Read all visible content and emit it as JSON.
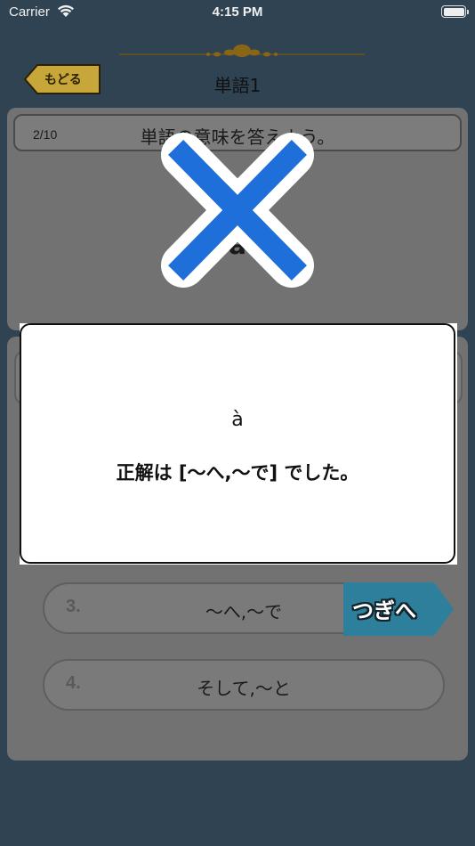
{
  "status_bar": {
    "carrier": "Carrier",
    "time": "4:15 PM"
  },
  "header": {
    "back_label": "もどる",
    "title": "単語1"
  },
  "question": {
    "progress": "2/10",
    "prompt": "単語の意味を答えよう。",
    "word": "à"
  },
  "answers": [
    {
      "number": "3.",
      "text": "〜へ,〜で"
    },
    {
      "number": "4.",
      "text": "そして,〜と"
    }
  ],
  "next_label": "つぎへ",
  "result": {
    "word": "à",
    "message": "正解は [〜へ,〜で] でした。",
    "mark": "wrong"
  },
  "colors": {
    "background": "#2f4352",
    "back_button": "#c8a73a",
    "next_button": "#2e7f9c",
    "wrong_mark": "#1e6fd9"
  },
  "icons": [
    "wifi-icon",
    "battery-icon",
    "back-arrow-icon",
    "ornament-icon",
    "wrong-x-icon"
  ]
}
